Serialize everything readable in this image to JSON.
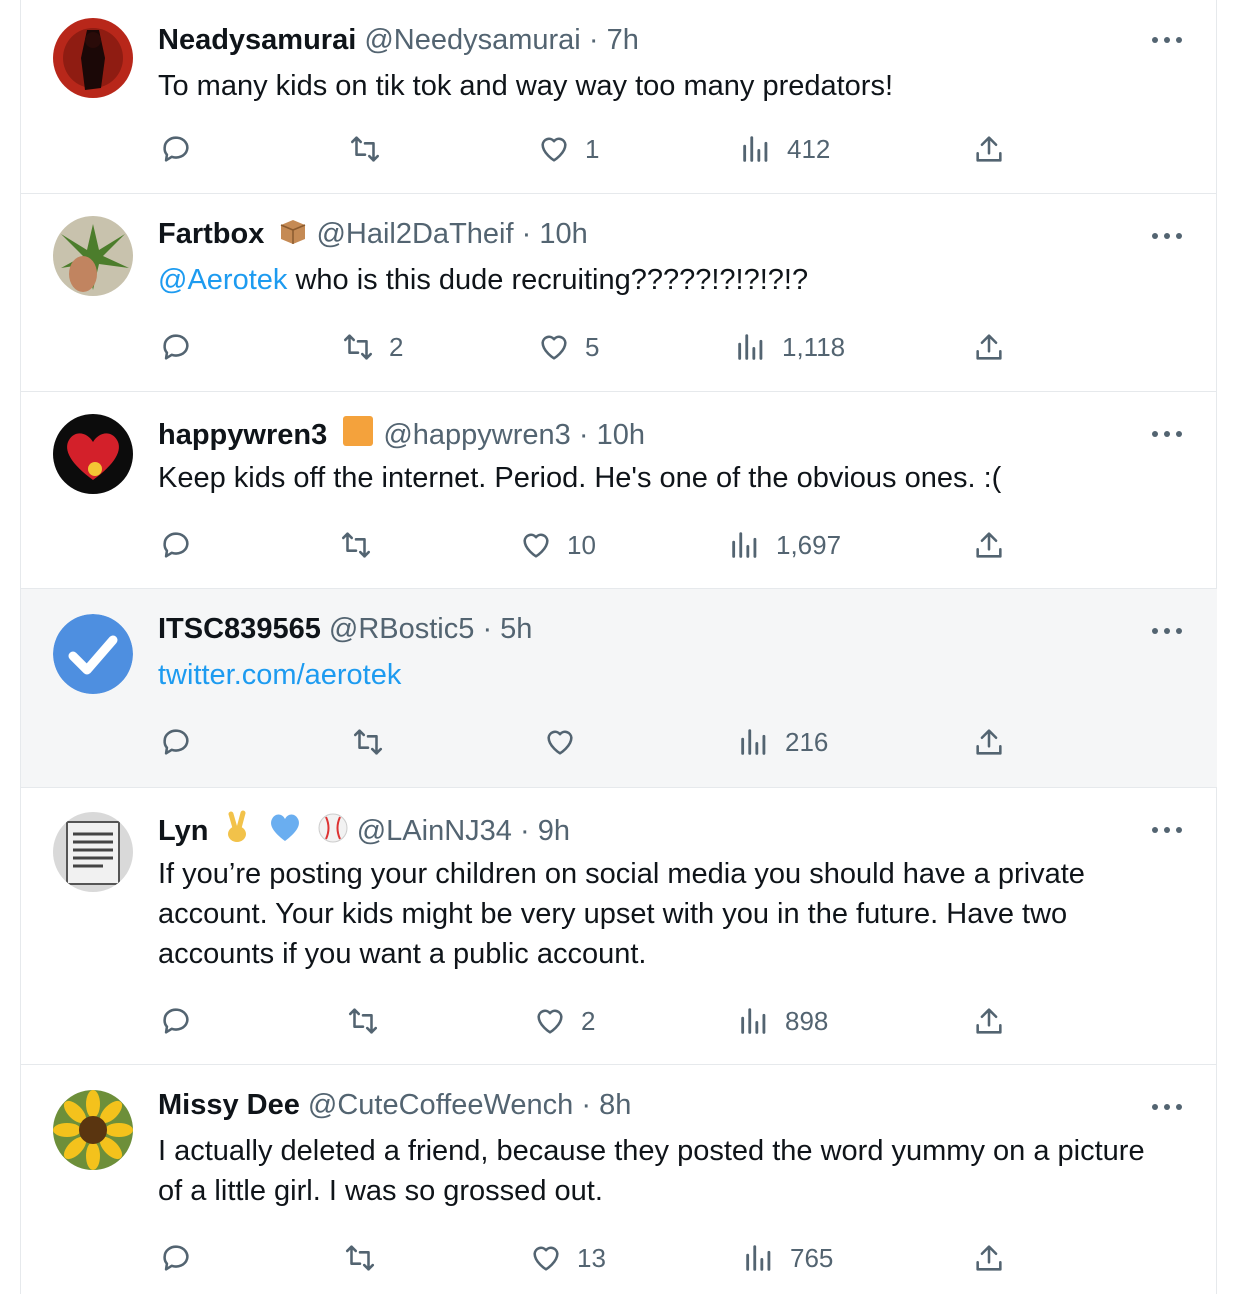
{
  "tweets": [
    {
      "name": "Neadysamurai",
      "handle": "@Needysamurai",
      "time": "7h",
      "body_mention": "",
      "body": "To many kids on tik tok and way way too many predators!",
      "replies": "",
      "retweets": "",
      "likes": "1",
      "views": "412"
    },
    {
      "name": "Fartbox",
      "handle": "@Hail2DaTheif",
      "time": "10h",
      "body_mention": "@Aerotek",
      "body": " who is this dude recruiting?????!?!?!?!?",
      "replies": "",
      "retweets": "2",
      "likes": "5",
      "views": "1,118"
    },
    {
      "name": "happywren3",
      "handle": "@happywren3",
      "time": "10h",
      "body_mention": "",
      "body": "Keep kids off the internet.  Period.  He's one of the obvious ones.  :(",
      "replies": "",
      "retweets": "",
      "likes": "10",
      "views": "1,697"
    },
    {
      "name": "ITSC839565",
      "handle": "@RBostic5",
      "time": "5h",
      "body_mention": "twitter.com/aerotek",
      "body": "",
      "replies": "",
      "retweets": "",
      "likes": "",
      "views": "216"
    },
    {
      "name": "Lyn",
      "handle": "@LAinNJ34",
      "time": "9h",
      "body_mention": "",
      "body": "If you’re posting your children on social media you should have a private account. Your kids might be very upset with you in the future. Have two accounts if you want a public account.",
      "replies": "",
      "retweets": "",
      "likes": "2",
      "views": "898"
    },
    {
      "name": "Missy Dee",
      "handle": "@CuteCoffeeWench",
      "time": "8h",
      "body_mention": "",
      "body": "I actually deleted a friend, because they posted the word yummy on a picture of a little girl.  I was so grossed out.",
      "replies": "",
      "retweets": "",
      "likes": "13",
      "views": "765"
    }
  ],
  "separator": "·",
  "icons": [
    "reply-icon",
    "retweet-icon",
    "like-icon",
    "views-icon",
    "share-icon",
    "more-icon"
  ],
  "colors": {
    "link": "#1d9bf0",
    "muted": "#536471",
    "text": "#0f1419",
    "highlight_bg": "#f5f6f7"
  }
}
